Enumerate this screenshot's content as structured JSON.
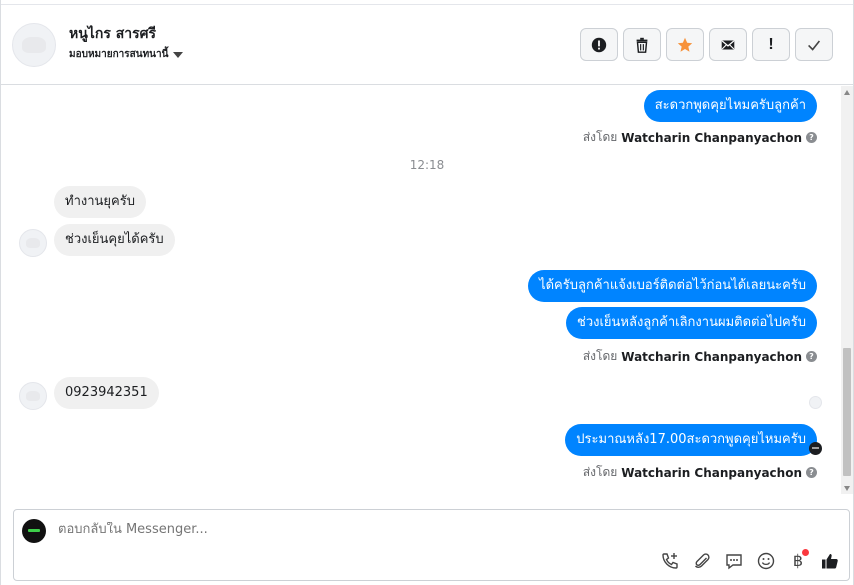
{
  "header": {
    "contact_name": "หนูไกร สารศรี",
    "assign_label": "มอบหมายการสนทนานี้"
  },
  "conversation": {
    "timestamp": "12:18",
    "messages": [
      {
        "direction": "out",
        "text": "สะดวกพูดคุยไหมครับลูกค้า"
      },
      {
        "direction": "in",
        "text": "ทำงานยุครับ"
      },
      {
        "direction": "in",
        "text": "ช่วงเย็นคุยได้ครับ"
      },
      {
        "direction": "out",
        "text": "ได้ครับลูกค้าแจ้งเบอร์ติดต่อไว้ก่อนได้เลยนะครับ"
      },
      {
        "direction": "out",
        "text": "ช่วงเย็นหลังลูกค้าเลิกงานผมติดต่อไปครับ"
      },
      {
        "direction": "in",
        "text": "0923942351"
      },
      {
        "direction": "out",
        "text": "ประมาณหลัง17.00สะดวกพูดคุยไหมครับ"
      }
    ],
    "sent_by_prefix": "ส่งโดย",
    "sent_by_name": "Watcharin Chanpanyachon"
  },
  "composer": {
    "placeholder": "ตอบกลับใน Messenger..."
  },
  "icons": {
    "header_actions": [
      "alert-icon",
      "trash-icon",
      "star-icon",
      "mail-icon",
      "exclamation-icon",
      "check-icon"
    ],
    "composer_tools": [
      "phone-add-icon",
      "paperclip-icon",
      "chat-bubble-icon",
      "emoji-icon",
      "baht-icon",
      "thumbs-up-icon"
    ]
  },
  "colors": {
    "accent": "#0084ff",
    "star": "#f7923b",
    "incoming_bubble": "#f0f0f0"
  }
}
